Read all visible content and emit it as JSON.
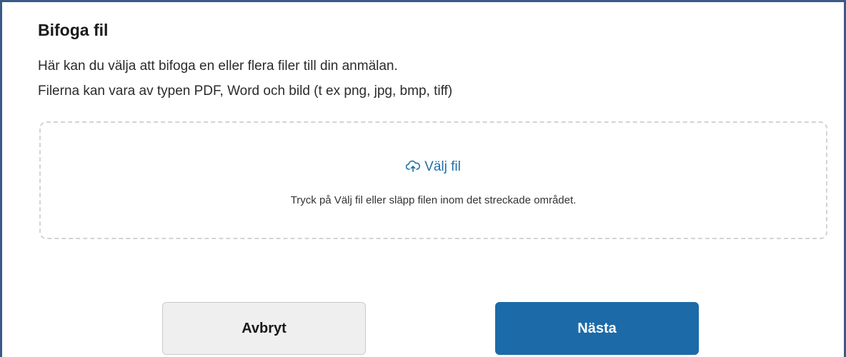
{
  "section": {
    "title": "Bifoga fil",
    "description_line1": "Här kan du välja att bifoga en eller flera filer till din anmälan.",
    "description_line2": "Filerna kan vara av typen PDF, Word och bild (t ex png, jpg, bmp, tiff)"
  },
  "dropzone": {
    "choose_file_label": "Välj fil",
    "choose_file_icon": "cloud-upload-icon",
    "hint": "Tryck på Välj fil eller släpp filen inom det streckade området."
  },
  "actions": {
    "cancel_label": "Avbryt",
    "next_label": "Nästa"
  },
  "colors": {
    "frame_border": "#3a5a87",
    "link": "#1f6ea8",
    "primary_button": "#1c6aa8",
    "secondary_button": "#efefef"
  }
}
